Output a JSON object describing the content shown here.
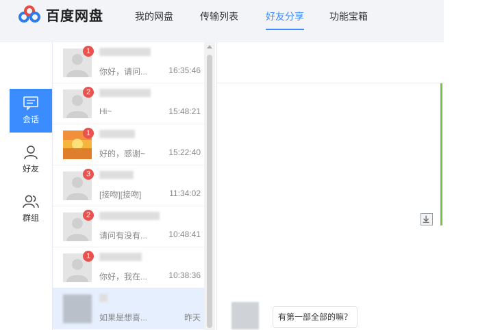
{
  "app": {
    "logo_text": "百度网盘"
  },
  "nav": {
    "items": [
      {
        "label": "我的网盘"
      },
      {
        "label": "传输列表"
      },
      {
        "label": "好友分享",
        "active": true
      },
      {
        "label": "功能宝箱"
      }
    ]
  },
  "sidebar": {
    "items": [
      {
        "label": "会话",
        "icon": "chat-icon",
        "active": true
      },
      {
        "label": "好友",
        "icon": "person-icon"
      },
      {
        "label": "群组",
        "icon": "group-icon"
      }
    ]
  },
  "conversations": [
    {
      "badge": "1",
      "preview": "你好，请问...",
      "time": "16:35:46",
      "avatar": "default"
    },
    {
      "badge": "2",
      "preview": "Hi~",
      "time": "15:48:21",
      "avatar": "default"
    },
    {
      "badge": "1",
      "preview": "好的，感谢~",
      "time": "15:22:40",
      "avatar": "sunset"
    },
    {
      "badge": "3",
      "preview": "[接吻][接吻]",
      "time": "11:34:02",
      "avatar": "default"
    },
    {
      "badge": "2",
      "preview": "请问有没有...",
      "time": "10:48:41",
      "avatar": "default"
    },
    {
      "badge": "1",
      "preview": "你好，我在...",
      "time": "10:38:36",
      "avatar": "default"
    },
    {
      "badge": "",
      "preview": "如果是想喜...",
      "time": "昨天",
      "avatar": "pixel",
      "selected": true
    }
  ],
  "chat": {
    "message": "有第一部全部的嘛？"
  },
  "colors": {
    "accent": "#3b8cff",
    "badge": "#e8524f",
    "indicator": "#7bc142"
  }
}
